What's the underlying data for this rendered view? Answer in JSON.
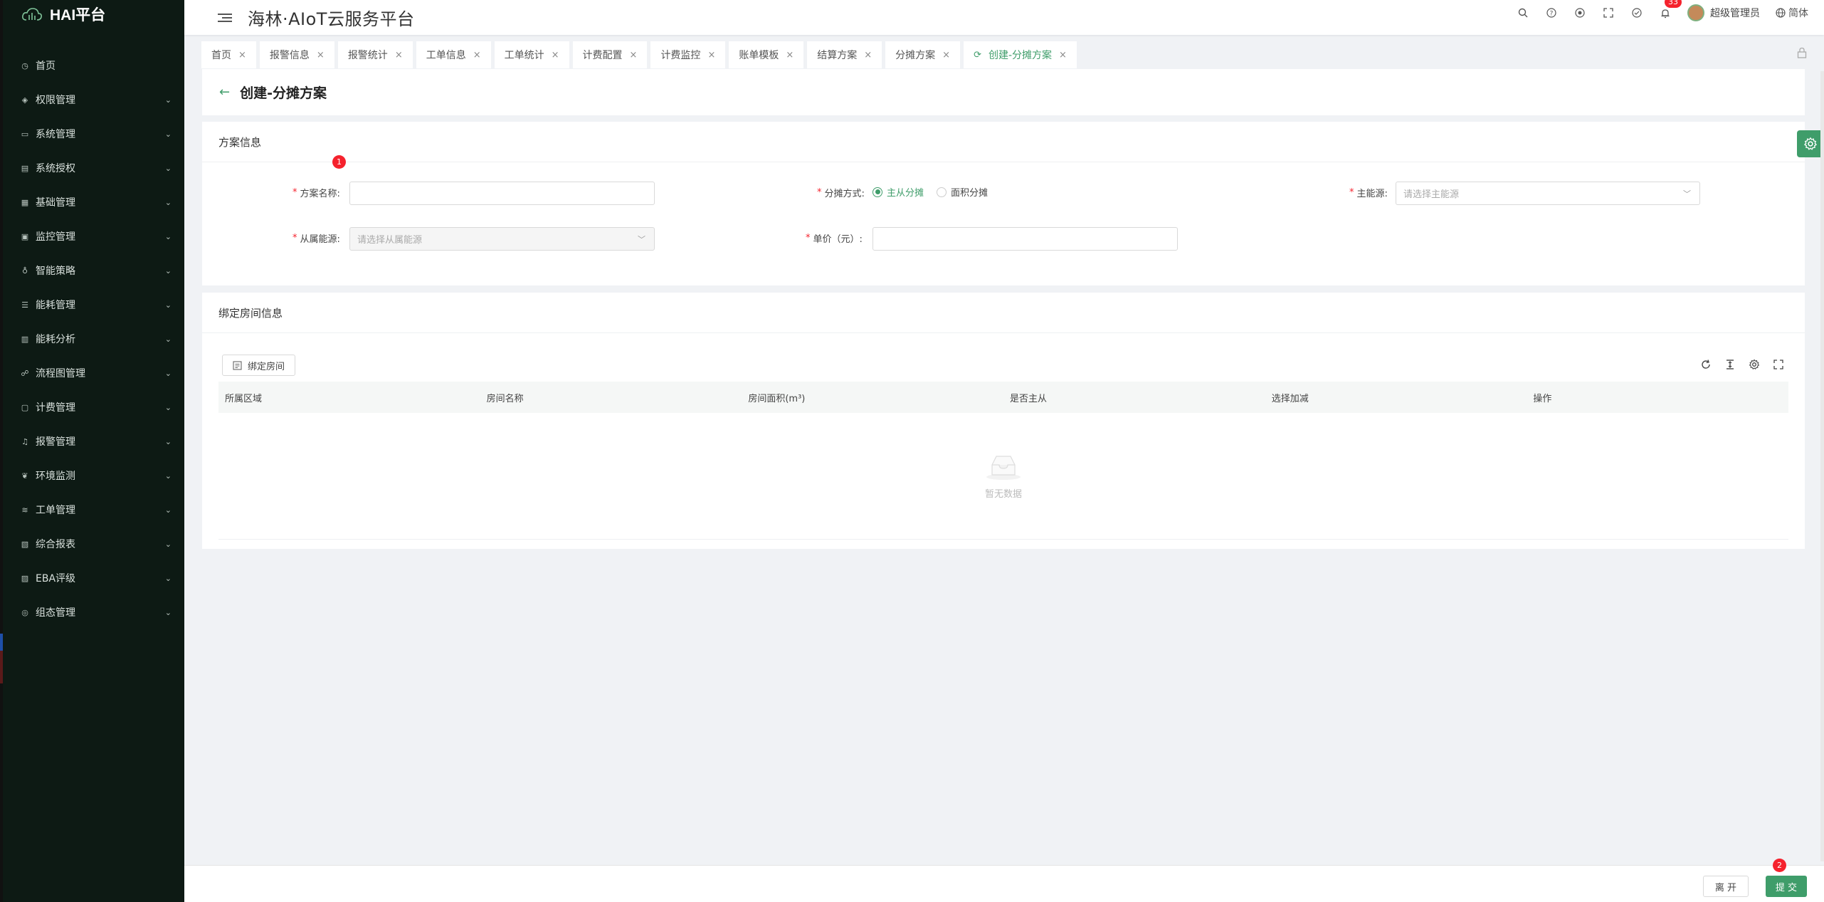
{
  "brand": {
    "name": "HAI平台"
  },
  "sidebar": {
    "items": [
      {
        "label": "首页",
        "icon": "dashboard-icon",
        "glyph": "◷",
        "expandable": false
      },
      {
        "label": "权限管理",
        "icon": "shield-icon",
        "glyph": "◈",
        "expandable": true
      },
      {
        "label": "系统管理",
        "icon": "monitor-icon",
        "glyph": "▭",
        "expandable": true
      },
      {
        "label": "系统授权",
        "icon": "license-icon",
        "glyph": "▤",
        "expandable": true
      },
      {
        "label": "基础管理",
        "icon": "database-icon",
        "glyph": "▦",
        "expandable": true
      },
      {
        "label": "监控管理",
        "icon": "monitor-screen-icon",
        "glyph": "▣",
        "expandable": true
      },
      {
        "label": "智能策略",
        "icon": "bulb-icon",
        "glyph": "♁",
        "expandable": true
      },
      {
        "label": "能耗管理",
        "icon": "sliders-icon",
        "glyph": "☰",
        "expandable": true
      },
      {
        "label": "能耗分析",
        "icon": "bar-chart-icon",
        "glyph": "▥",
        "expandable": true
      },
      {
        "label": "流程图管理",
        "icon": "flow-icon",
        "glyph": "☍",
        "expandable": true
      },
      {
        "label": "计费管理",
        "icon": "billing-icon",
        "glyph": "▢",
        "expandable": true
      },
      {
        "label": "报警管理",
        "icon": "alarm-icon",
        "glyph": "♫",
        "expandable": true
      },
      {
        "label": "环境监测",
        "icon": "leaf-icon",
        "glyph": "❦",
        "expandable": true
      },
      {
        "label": "工单管理",
        "icon": "layers-icon",
        "glyph": "≋",
        "expandable": true
      },
      {
        "label": "综合报表",
        "icon": "report-icon",
        "glyph": "▧",
        "expandable": true
      },
      {
        "label": "EBA评级",
        "icon": "rating-icon",
        "glyph": "▨",
        "expandable": true
      },
      {
        "label": "组态管理",
        "icon": "config-icon",
        "glyph": "◎",
        "expandable": true
      }
    ]
  },
  "header": {
    "title": "海林·AIoT云服务平台",
    "notification_count": "33",
    "user_name": "超级管理员",
    "language": "简体"
  },
  "tabs": [
    {
      "label": "首页",
      "active": false
    },
    {
      "label": "报警信息",
      "active": false
    },
    {
      "label": "报警统计",
      "active": false
    },
    {
      "label": "工单信息",
      "active": false
    },
    {
      "label": "工单统计",
      "active": false
    },
    {
      "label": "计费配置",
      "active": false
    },
    {
      "label": "计费监控",
      "active": false
    },
    {
      "label": "账单模板",
      "active": false
    },
    {
      "label": "结算方案",
      "active": false
    },
    {
      "label": "分摊方案",
      "active": false
    },
    {
      "label": "创建-分摊方案",
      "active": true
    }
  ],
  "page": {
    "title": "创建-分摊方案"
  },
  "plan_info": {
    "section_title": "方案信息",
    "step_badge": "1",
    "name_label": "方案名称:",
    "name_value": "",
    "method_label": "分摊方式:",
    "method_options": [
      "主从分摊",
      "面积分摊"
    ],
    "method_selected": "主从分摊",
    "main_energy_label": "主能源:",
    "main_energy_placeholder": "请选择主能源",
    "sub_energy_label": "从属能源:",
    "sub_energy_placeholder": "请选择从属能源",
    "price_label": "单价（元）:",
    "price_value": ""
  },
  "room_info": {
    "section_title": "绑定房间信息",
    "bind_button": "绑定房间",
    "columns": [
      "所属区域",
      "房间名称",
      "房间面积(m³)",
      "是否主从",
      "选择加减",
      "操作"
    ],
    "rows": [],
    "empty_text": "暂无数据"
  },
  "footer": {
    "leave_label": "离 开",
    "submit_label": "提 交",
    "step_badge": "2"
  },
  "colors": {
    "primary": "#3f9d6a",
    "sidebar_bg": "#0d1a14",
    "badge_red": "#f5222d"
  }
}
